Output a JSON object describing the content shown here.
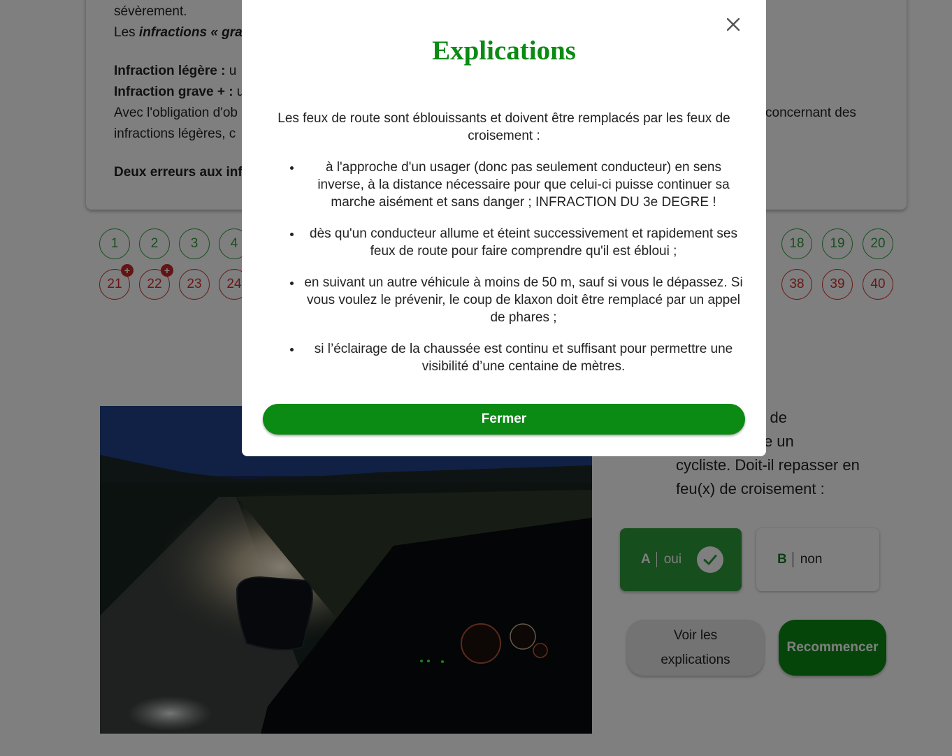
{
  "background": {
    "card_lines": {
      "line1": "sévèrement.",
      "line2_prefix": "Les ",
      "line2_italic": "infractions « gra",
      "line3_bold": "Infraction légère : ",
      "line3_rest": "u",
      "line4_bold": "Infraction grave + : ",
      "line4_rest": "u",
      "line5_left": "Avec l'obligation d'ob",
      "line5_right": "concernant des",
      "line6": "infractions légères, c",
      "line7_bold": "Deux erreurs aux inf"
    },
    "question_numbers_row1": [
      "1",
      "2",
      "3",
      "4",
      "18",
      "19",
      "20"
    ],
    "question_numbers_row2": [
      "21",
      "22",
      "23",
      "24",
      "38",
      "39",
      "40"
    ],
    "badge_plus": "+",
    "question_text": "lant en feu(x) de\nducteur croise un\ncycliste. Doit-il repasser en\nfeu(x) de croisement :",
    "answers": [
      {
        "letter": "A",
        "label": "oui",
        "selected": true,
        "correct": true
      },
      {
        "letter": "B",
        "label": "non",
        "selected": false
      }
    ],
    "btn_explain": "Voir les\nexplications",
    "btn_restart": "Recommencer"
  },
  "modal": {
    "title": "Explications",
    "intro": "Les feux de route sont éblouissants et doivent être remplacés par les feux de croisement :",
    "items": [
      "à l'approche d'un usager (donc pas seulement conducteur) en sens inverse, à la distance nécessaire pour que celui-ci puisse continuer sa marche aisément et sans danger ; INFRACTION DU 3e DEGRE !",
      "dès qu'un conducteur allume et éteint successivement et rapidement ses feux de route pour faire comprendre qu'il est ébloui ;",
      "en suivant un autre véhicule à moins de 50 m, sauf si vous le dépassez. Si vous voulez le prévenir, le coup de klaxon doit être remplacé par un appel de phares ;",
      "si l’éclairage de la chaussée est continu et suffisant pour permettre une visibilité d’une centaine de mètres."
    ],
    "close_button": "Fermer"
  },
  "colors": {
    "accent_green": "#0b8a14",
    "correct_green": "#2e9d3a",
    "error_red": "#d32f2f"
  }
}
